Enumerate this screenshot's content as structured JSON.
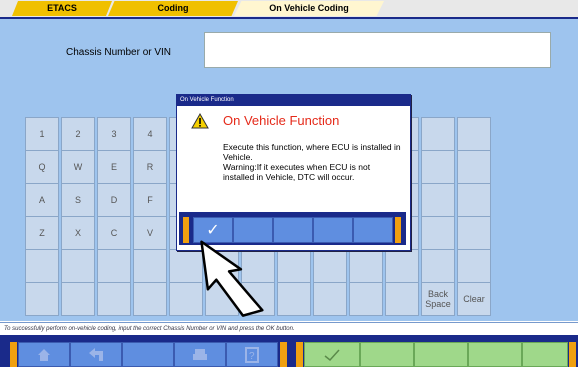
{
  "tabs": [
    "ETACS",
    "Coding",
    "On Vehicle Coding"
  ],
  "vin": {
    "label": "Chassis Number or VIN",
    "value": ""
  },
  "keypad": {
    "row1": [
      "1",
      "2",
      "3",
      "4",
      "",
      "",
      "",
      "",
      "",
      "",
      "",
      "",
      ""
    ],
    "row2": [
      "Q",
      "W",
      "E",
      "R",
      "",
      "",
      "",
      "",
      "",
      "",
      "",
      "",
      ""
    ],
    "row3": [
      "A",
      "S",
      "D",
      "F",
      "",
      "",
      "",
      "",
      "",
      "",
      "-",
      "",
      ""
    ],
    "row4": [
      "Z",
      "X",
      "C",
      "V",
      "",
      "",
      "",
      "",
      "",
      "",
      "",
      "",
      ""
    ],
    "row5": [
      "",
      "",
      "",
      "",
      "",
      "",
      "",
      "",
      "",
      "",
      "",
      "",
      ""
    ],
    "row6": [
      "",
      "",
      "",
      "",
      "",
      "",
      "",
      "",
      "",
      "",
      "",
      "Back Space",
      "Clear"
    ]
  },
  "status_text": "To successfully perform on-vehicle coding, input the correct Chassis Number or VIN and press the OK button.",
  "dialog": {
    "title": "On Vehicle Function",
    "heading": "On Vehicle Function",
    "message": "Execute this function, where ECU is installed in Vehicle.\nWarning:If it executes when ECU is not installed in Vehicle, DTC will occur.",
    "ok_symbol": "✓"
  },
  "toolbar": {
    "home_icon": "home-icon",
    "back_icon": "back-arrow-icon",
    "print_icon": "printer-icon",
    "help_icon": "help-icon",
    "ok_icon": "checkmark-icon"
  },
  "colors": {
    "accent": "#1a2a8a",
    "panel": "#9ec4ee",
    "tab": "#f0c000",
    "warning": "#e52a1a"
  }
}
